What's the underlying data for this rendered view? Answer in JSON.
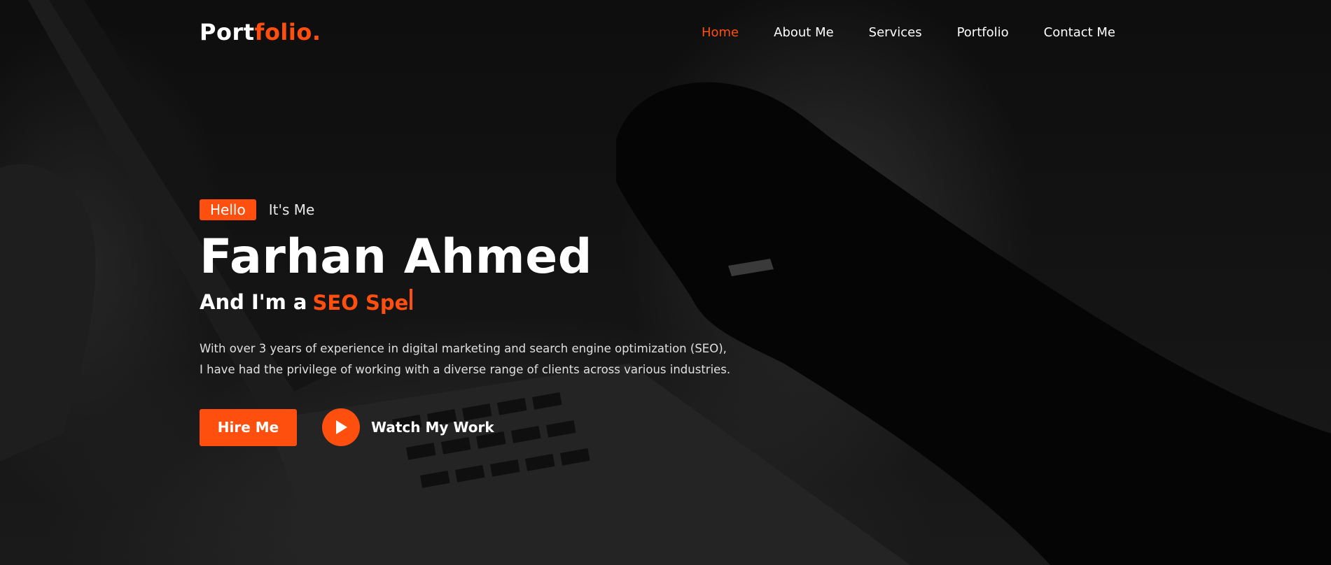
{
  "header": {
    "logo_main": "Port",
    "logo_accent": "folio.",
    "nav": [
      {
        "label": "Home",
        "active": true
      },
      {
        "label": "About Me",
        "active": false
      },
      {
        "label": "Services",
        "active": false
      },
      {
        "label": "Portfolio",
        "active": false
      },
      {
        "label": "Contact Me",
        "active": false
      }
    ]
  },
  "hero": {
    "badge": "Hello",
    "intro": "It's Me",
    "name": "Farhan Ahmed",
    "role_prefix": "And I'm a",
    "role_typed": "SEO Spe",
    "bio_line1": "With over 3 years of experience in digital marketing and search engine optimization (SEO),",
    "bio_line2": "I have had the privilege of working with a diverse range of clients across various industries.",
    "hire_label": "Hire Me",
    "watch_label": "Watch My Work"
  },
  "colors": {
    "accent": "#ff4f0f",
    "background": "#0b0b0b",
    "text": "#ffffff"
  },
  "icons": {
    "play": "play-icon"
  }
}
